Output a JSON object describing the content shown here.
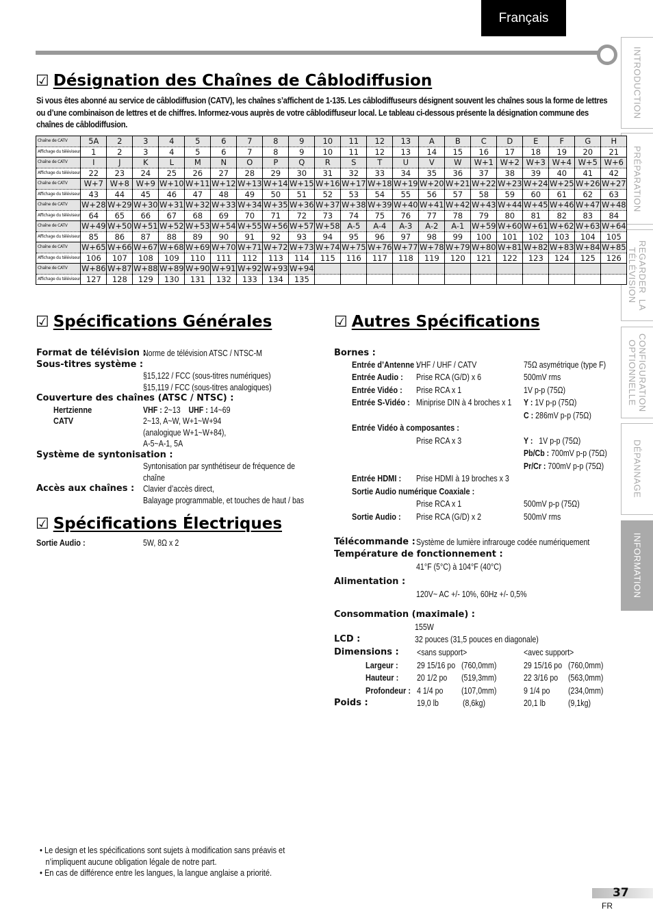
{
  "header": {
    "language": "Français"
  },
  "side_tabs": [
    {
      "label": "INTRODUCTION",
      "active": false
    },
    {
      "label": "PRÉPARATION",
      "active": false
    },
    {
      "label": "REGARDER  LA\nTÉLÉVISION",
      "active": false
    },
    {
      "label": "CONFIGURATION\nOPTIONNELLE",
      "active": false
    },
    {
      "label": "DÉPANNAGE",
      "active": false
    },
    {
      "label": "INFORMATION",
      "active": true
    }
  ],
  "cable_section": {
    "title": "Désignation des Chaînes de Câblodiffusion",
    "intro": "Si vous êtes abonné au service de câblodiffusion (CATV), les chaînes s’affichent de 1-135. Les câblodiffuseurs désignent souvent les chaînes sous la forme de lettres ou d’une combinaison de lettres et de chiffres. Informez-vous auprès de votre câblodiffuseur local. Le tableau ci-dessous présente la désignation commune des chaînes de câblodiffusion.",
    "row_label_catv": "Chaîne de  CATV",
    "row_label_display": "Affichage du téléviseur",
    "rows": [
      {
        "catv": [
          "5A",
          "2",
          "3",
          "4",
          "5",
          "6",
          "7",
          "8",
          "9",
          "10",
          "11",
          "12",
          "13",
          "A",
          "B",
          "C",
          "D",
          "E",
          "F",
          "G",
          "H"
        ],
        "display": [
          "1",
          "2",
          "3",
          "4",
          "5",
          "6",
          "7",
          "8",
          "9",
          "10",
          "11",
          "12",
          "13",
          "14",
          "15",
          "16",
          "17",
          "18",
          "19",
          "20",
          "21"
        ]
      },
      {
        "catv": [
          "I",
          "J",
          "K",
          "L",
          "M",
          "N",
          "O",
          "P",
          "Q",
          "R",
          "S",
          "T",
          "U",
          "V",
          "W",
          "W+1",
          "W+2",
          "W+3",
          "W+4",
          "W+5",
          "W+6"
        ],
        "display": [
          "22",
          "23",
          "24",
          "25",
          "26",
          "27",
          "28",
          "29",
          "30",
          "31",
          "32",
          "33",
          "34",
          "35",
          "36",
          "37",
          "38",
          "39",
          "40",
          "41",
          "42"
        ]
      },
      {
        "catv": [
          "W+7",
          "W+8",
          "W+9",
          "W+10",
          "W+11",
          "W+12",
          "W+13",
          "W+14",
          "W+15",
          "W+16",
          "W+17",
          "W+18",
          "W+19",
          "W+20",
          "W+21",
          "W+22",
          "W+23",
          "W+24",
          "W+25",
          "W+26",
          "W+27"
        ],
        "display": [
          "43",
          "44",
          "45",
          "46",
          "47",
          "48",
          "49",
          "50",
          "51",
          "52",
          "53",
          "54",
          "55",
          "56",
          "57",
          "58",
          "59",
          "60",
          "61",
          "62",
          "63"
        ]
      },
      {
        "catv": [
          "W+28",
          "W+29",
          "W+30",
          "W+31",
          "W+32",
          "W+33",
          "W+34",
          "W+35",
          "W+36",
          "W+37",
          "W+38",
          "W+39",
          "W+40",
          "W+41",
          "W+42",
          "W+43",
          "W+44",
          "W+45",
          "W+46",
          "W+47",
          "W+48"
        ],
        "display": [
          "64",
          "65",
          "66",
          "67",
          "68",
          "69",
          "70",
          "71",
          "72",
          "73",
          "74",
          "75",
          "76",
          "77",
          "78",
          "79",
          "80",
          "81",
          "82",
          "83",
          "84"
        ]
      },
      {
        "catv": [
          "W+49",
          "W+50",
          "W+51",
          "W+52",
          "W+53",
          "W+54",
          "W+55",
          "W+56",
          "W+57",
          "W+58",
          "A-5",
          "A-4",
          "A-3",
          "A-2",
          "A-1",
          "W+59",
          "W+60",
          "W+61",
          "W+62",
          "W+63",
          "W+64"
        ],
        "display": [
          "85",
          "86",
          "87",
          "88",
          "89",
          "90",
          "91",
          "92",
          "93",
          "94",
          "95",
          "96",
          "97",
          "98",
          "99",
          "100",
          "101",
          "102",
          "103",
          "104",
          "105"
        ]
      },
      {
        "catv": [
          "W+65",
          "W+66",
          "W+67",
          "W+68",
          "W+69",
          "W+70",
          "W+71",
          "W+72",
          "W+73",
          "W+74",
          "W+75",
          "W+76",
          "W+77",
          "W+78",
          "W+79",
          "W+80",
          "W+81",
          "W+82",
          "W+83",
          "W+84",
          "W+85"
        ],
        "display": [
          "106",
          "107",
          "108",
          "109",
          "110",
          "111",
          "112",
          "113",
          "114",
          "115",
          "116",
          "117",
          "118",
          "119",
          "120",
          "121",
          "122",
          "123",
          "124",
          "125",
          "126"
        ]
      },
      {
        "catv": [
          "W+86",
          "W+87",
          "W+88",
          "W+89",
          "W+90",
          "W+91",
          "W+92",
          "W+93",
          "W+94",
          "",
          "",
          "",
          "",
          "",
          "",
          "",
          "",
          "",
          "",
          "",
          ""
        ],
        "display": [
          "127",
          "128",
          "129",
          "130",
          "131",
          "132",
          "133",
          "134",
          "135",
          "",
          "",
          "",
          "",
          "",
          "",
          "",
          "",
          "",
          "",
          "",
          ""
        ]
      }
    ]
  },
  "general_specs": {
    "title": "Spécifications Générales",
    "format_label": "Format de télévision :",
    "format_value": "Norme de télévision ATSC / NTSC-M",
    "subtitles_label": "Sous-titres système :",
    "subtitles_values": [
      "§15,122 / FCC (sous-titres numériques)",
      "§15,119 / FCC (sous-titres analogiques)"
    ],
    "coverage_label": "Couverture des chaînes (ATSC / NTSC) :",
    "hertz_label": "Hertzienne",
    "hertz_vhf_label": "VHF :",
    "hertz_vhf_value": "2~13",
    "hertz_uhf_label": "UHF :",
    "hertz_uhf_value": "14~69",
    "catv_label": "CATV",
    "catv_values": [
      "2~13, A~W, W+1~W+94",
      "(analogique W+1~W+84),",
      "A-5~A-1, 5A"
    ],
    "tuning_label": "Système de syntonisation :",
    "tuning_values": [
      "Syntonisation par synthétiseur de fréquence de",
      "chaîne"
    ],
    "access_label": "Accès aux chaînes :",
    "access_values": [
      "Clavier d’accès direct,",
      "Balayage programmable, et touches de haut / bas"
    ]
  },
  "electrical_specs": {
    "title": "Spécifications Électriques",
    "audio_label": "Sortie Audio :",
    "audio_value": "5W, 8Ω x 2"
  },
  "other_specs": {
    "title": "Autres Spécifications",
    "terminals_label": "Bornes :",
    "antenna_label": "Entrée d’Antenne :",
    "antenna_value": "VHF / UHF / CATV",
    "antenna_spec": "75Ω asymétrique (type F)",
    "audio_in_label": "Entrée Audio :",
    "audio_in_value": "Prise RCA (G/D) x 6",
    "audio_in_spec": "500mV rms",
    "video_in_label": "Entrée Vidéo :",
    "video_in_value": "Prise RCA x 1",
    "video_in_spec": "1V p-p (75Ω)",
    "svideo_label": "Entrée S-Vidéo :",
    "svideo_value": "Miniprise DIN à 4 broches x 1",
    "svideo_y_label": "Y :",
    "svideo_y_value": "1V p-p (75Ω)",
    "svideo_c_label": "C :",
    "svideo_c_value": "286mV p-p (75Ω)",
    "component_label": "Entrée Vidéo à composantes :",
    "component_value": "Prise RCA x 3",
    "component_y_label": "Y :",
    "component_y_value": "1V p-p (75Ω)",
    "component_pb_label": "Pb/Cb :",
    "component_pb_value": "700mV p-p (75Ω)",
    "component_pr_label": "Pr/Cr :",
    "component_pr_value": "700mV p-p (75Ω)",
    "hdmi_label": "Entrée HDMI :",
    "hdmi_value": "Prise HDMI à 19 broches x 3",
    "coax_label": "Sortie Audio numérique Coaxiale :",
    "coax_value": "Prise RCA x 1",
    "coax_spec": "500mV p-p (75Ω)",
    "audio_out_label": "Sortie Audio :",
    "audio_out_value": "Prise RCA (G/D) x 2",
    "audio_out_spec": "500mV rms",
    "remote_label": "Télécommande :",
    "remote_value": "Système de lumière infrarouge codée numériquement",
    "temp_label": "Température de fonctionnement :",
    "temp_value": "41°F (5°C) à 104°F (40°C)",
    "power_label": "Alimentation :",
    "power_value": "120V~ AC +/- 10%, 60Hz +/- 0,5%",
    "consumption_label": "Consommation (maximale) :",
    "consumption_value": "155W",
    "lcd_label": "LCD :",
    "lcd_value": "32 pouces (31,5 pouces en diagonale)",
    "dimensions_label": "Dimensions :",
    "without_stand": "<sans support>",
    "with_stand": "<avec support>",
    "width_label": "Largeur :",
    "width_a_in": "29 15/16 po",
    "width_a_mm": "(760,0mm)",
    "width_b_in": "29 15/16 po",
    "width_b_mm": "(760,0mm)",
    "height_label": "Hauteur :",
    "height_a_in": "20 1/2 po",
    "height_a_mm": "(519,3mm)",
    "height_b_in": "22 3/16 po",
    "height_b_mm": "(563,0mm)",
    "depth_label": "Profondeur :",
    "depth_a_in": "4 1/4 po",
    "depth_a_mm": "(107,0mm)",
    "depth_b_in": "9 1/4 po",
    "depth_b_mm": "(234,0mm)",
    "weight_label": "Poids :",
    "weight_a_lb": "19,0 lb",
    "weight_a_kg": "(8,6kg)",
    "weight_b_lb": "20,1 lb",
    "weight_b_kg": "(9,1kg)"
  },
  "notes": [
    "• Le design et les spécifications sont sujets à modification sans préavis et",
    "  n’impliquent aucune obligation légale de notre part.",
    "• En cas de différence entre les langues, la langue anglaise a priorité."
  ],
  "footer": {
    "page_number": "37",
    "lang_code": "FR"
  },
  "icons": {
    "section_marker": "checkbox-checked-icon"
  }
}
